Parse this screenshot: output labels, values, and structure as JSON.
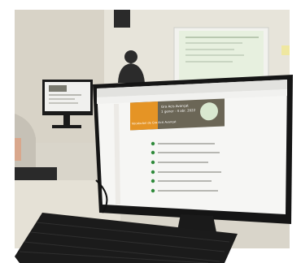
{
  "photo": {
    "banner": {
      "line1": "Gra Acis Avançat",
      "line2": "1 gener - 4 abr. 2022",
      "left_caption": "Vocabulari de Gra Acis Avançat"
    },
    "list_item_count": 6
  },
  "colors": {
    "wall": "#e9e6dd",
    "floor": "#d8d4c8",
    "monitor_bezel": "#151515",
    "screen": "#f6f6f4",
    "banner_bg": "#6b6656",
    "banner_orange": "#e59425",
    "list_icon_green": "#2f8a3a",
    "projector_screen": "#e7f0df",
    "keyboard": "#1b1b1b"
  }
}
